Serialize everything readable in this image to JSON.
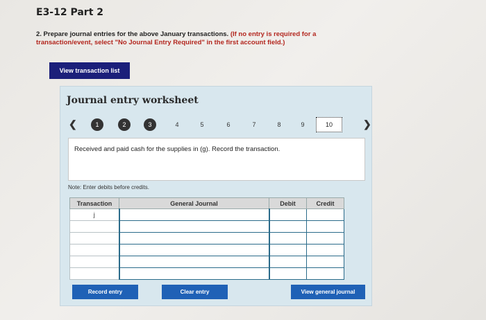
{
  "page": {
    "title": "E3-12 Part 2",
    "instructions": "2. Prepare journal entries for the above January transactions.",
    "instructions_note": "(If no entry is required for a transaction/event, select \"No Journal Entry Required\" in the first account field.)",
    "view_transaction_list": "View transaction list"
  },
  "worksheet": {
    "title": "Journal entry worksheet",
    "prev_icon": "chevron-left-icon",
    "next_icon": "chevron-right-icon",
    "steps": [
      {
        "label": "1",
        "state": "done"
      },
      {
        "label": "2",
        "state": "done"
      },
      {
        "label": "3",
        "state": "done"
      },
      {
        "label": "4",
        "state": "todo"
      },
      {
        "label": "5",
        "state": "todo"
      },
      {
        "label": "6",
        "state": "todo"
      },
      {
        "label": "7",
        "state": "todo"
      },
      {
        "label": "8",
        "state": "todo"
      },
      {
        "label": "9",
        "state": "todo"
      },
      {
        "label": "10",
        "state": "current"
      }
    ],
    "description": "Received and paid cash for the supplies in (g). Record the transaction.",
    "note": "Note: Enter debits before credits.",
    "table": {
      "headers": [
        "Transaction",
        "General Journal",
        "Debit",
        "Credit"
      ],
      "rows": [
        {
          "transaction": "j",
          "account": "",
          "debit": "",
          "credit": ""
        },
        {
          "transaction": "",
          "account": "",
          "debit": "",
          "credit": ""
        },
        {
          "transaction": "",
          "account": "",
          "debit": "",
          "credit": ""
        },
        {
          "transaction": "",
          "account": "",
          "debit": "",
          "credit": ""
        },
        {
          "transaction": "",
          "account": "",
          "debit": "",
          "credit": ""
        },
        {
          "transaction": "",
          "account": "",
          "debit": "",
          "credit": ""
        }
      ]
    },
    "buttons": {
      "record": "Record entry",
      "clear": "Clear entry",
      "view_journal": "View general journal"
    }
  },
  "colors": {
    "navy_button": "#1b1f7a",
    "action_button": "#1f61b6",
    "worksheet_bg": "#d8e7ee",
    "note_red": "#b3261e"
  }
}
